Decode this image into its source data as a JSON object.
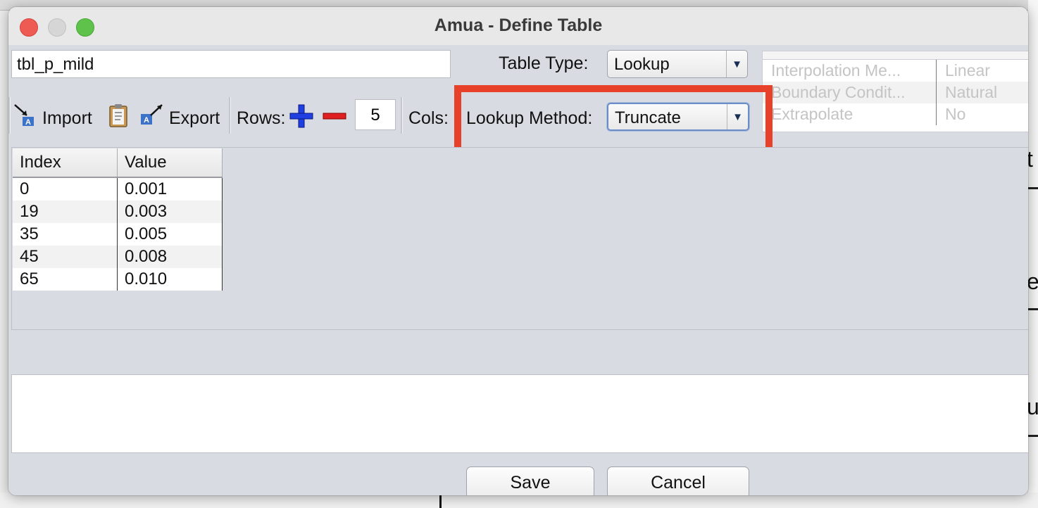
{
  "window": {
    "title": "Amua - Define Table"
  },
  "form": {
    "table_name": "tbl_p_mild",
    "table_type_label": "Table Type:",
    "table_type_value": "Lookup",
    "lookup_method_label": "Lookup Method:",
    "lookup_method_value": "Truncate"
  },
  "toolbar": {
    "import_label": "Import",
    "export_label": "Export",
    "rows_label": "Rows:",
    "rows_value": "5",
    "cols_label": "Cols:"
  },
  "interpolation_props": [
    {
      "key": "Interpolation Me...",
      "value": "Linear"
    },
    {
      "key": "Boundary Condit...",
      "value": "Natural"
    },
    {
      "key": "Extrapolate",
      "value": "No"
    }
  ],
  "table": {
    "headers": [
      "Index",
      "Value"
    ],
    "rows": [
      [
        "0",
        "0.001"
      ],
      [
        "19",
        "0.003"
      ],
      [
        "35",
        "0.005"
      ],
      [
        "45",
        "0.008"
      ],
      [
        "65",
        "0.010"
      ]
    ]
  },
  "buttons": {
    "save": "Save",
    "cancel": "Cancel"
  },
  "background": {
    "right_chars": [
      "t",
      "e",
      "u"
    ]
  },
  "colors": {
    "highlight": "#e8412a",
    "add_icon": "#1f3fe0",
    "remove_icon": "#e02020"
  }
}
